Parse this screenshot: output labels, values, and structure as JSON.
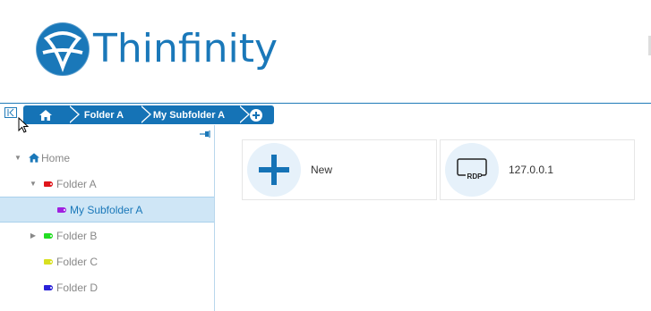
{
  "brand": {
    "logo_text": "Thinfinity",
    "color": "#1a78b9"
  },
  "breadcrumb": {
    "home_icon": "home-icon",
    "items": [
      {
        "label": "Folder A"
      },
      {
        "label": "My Subfolder A"
      }
    ],
    "add_icon": "plus-circle-icon",
    "color": "#1573b6"
  },
  "tree": {
    "home": {
      "label": "Home",
      "icon": "home-icon"
    },
    "folders": [
      {
        "label": "Folder A",
        "tag_color": "#e0161b",
        "expanded": true
      },
      {
        "label": "My Subfolder A",
        "tag_color": "#a020e0",
        "selected": true
      },
      {
        "label": "Folder B",
        "tag_color": "#22dd22",
        "expanded": false
      },
      {
        "label": "Folder C",
        "tag_color": "#d8e020"
      },
      {
        "label": "Folder D",
        "tag_color": "#2a22d8"
      }
    ]
  },
  "cards": [
    {
      "label": "New",
      "icon": "plus-icon"
    },
    {
      "label": "127.0.0.1",
      "icon": "rdp-icon",
      "icon_text": "RDP"
    }
  ]
}
